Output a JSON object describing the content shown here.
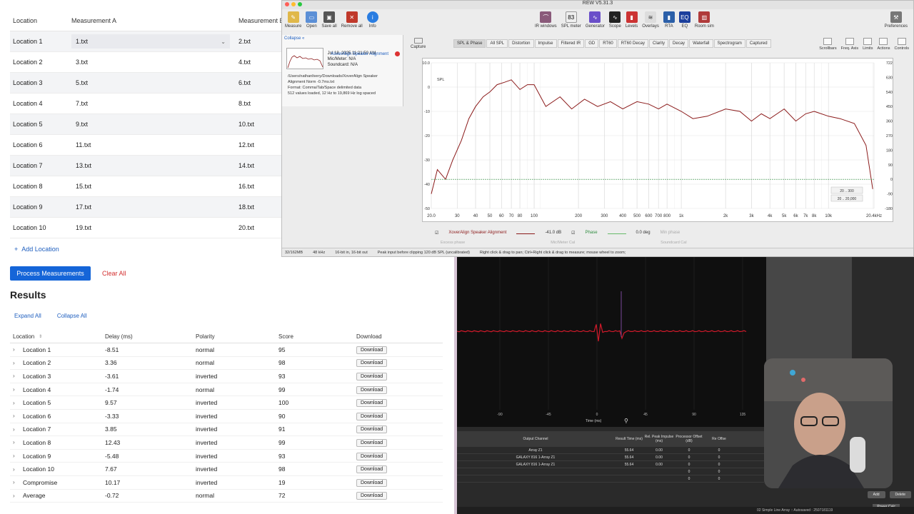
{
  "locations_table": {
    "headers": [
      "Location",
      "Measurement A",
      "Measurement B"
    ],
    "rows": [
      {
        "location": "Location 1",
        "a": "1.txt",
        "b": "2.txt"
      },
      {
        "location": "Location 2",
        "a": "3.txt",
        "b": "4.txt"
      },
      {
        "location": "Location 3",
        "a": "5.txt",
        "b": "6.txt"
      },
      {
        "location": "Location 4",
        "a": "7.txt",
        "b": "8.txt"
      },
      {
        "location": "Location 5",
        "a": "9.txt",
        "b": "10.txt"
      },
      {
        "location": "Location 6",
        "a": "11.txt",
        "b": "12.txt"
      },
      {
        "location": "Location 7",
        "a": "13.txt",
        "b": "14.txt"
      },
      {
        "location": "Location 8",
        "a": "15.txt",
        "b": "16.txt"
      },
      {
        "location": "Location 9",
        "a": "17.txt",
        "b": "18.txt"
      },
      {
        "location": "Location 10",
        "a": "19.txt",
        "b": "20.txt"
      }
    ],
    "add_location": "Add Location"
  },
  "actions": {
    "process": "Process Measurements",
    "clear": "Clear All"
  },
  "results": {
    "title": "Results",
    "expand_all": "Expand All",
    "collapse_all": "Collapse All",
    "headers": {
      "location": "Location",
      "delay": "Delay (ms)",
      "polarity": "Polarity",
      "score": "Score",
      "download": "Download"
    },
    "rows": [
      {
        "location": "Location 1",
        "delay": "-8.51",
        "polarity": "normal",
        "score": "95",
        "download": "Download"
      },
      {
        "location": "Location 2",
        "delay": "3.36",
        "polarity": "normal",
        "score": "98",
        "download": "Download"
      },
      {
        "location": "Location 3",
        "delay": "-3.61",
        "polarity": "inverted",
        "score": "93",
        "download": "Download"
      },
      {
        "location": "Location 4",
        "delay": "-1.74",
        "polarity": "normal",
        "score": "99",
        "download": "Download"
      },
      {
        "location": "Location 5",
        "delay": "9.57",
        "polarity": "inverted",
        "score": "100",
        "download": "Download"
      },
      {
        "location": "Location 6",
        "delay": "-3.33",
        "polarity": "inverted",
        "score": "90",
        "download": "Download"
      },
      {
        "location": "Location 7",
        "delay": "3.85",
        "polarity": "inverted",
        "score": "91",
        "download": "Download"
      },
      {
        "location": "Location 8",
        "delay": "12.43",
        "polarity": "inverted",
        "score": "99",
        "download": "Download"
      },
      {
        "location": "Location 9",
        "delay": "-5.48",
        "polarity": "inverted",
        "score": "93",
        "download": "Download"
      },
      {
        "location": "Location 10",
        "delay": "7.67",
        "polarity": "inverted",
        "score": "98",
        "download": "Download"
      },
      {
        "location": "Compromise",
        "delay": "10.17",
        "polarity": "inverted",
        "score": "19",
        "download": "Download"
      },
      {
        "location": "Average",
        "delay": "-0.72",
        "polarity": "normal",
        "score": "72",
        "download": "Download"
      }
    ]
  },
  "rew": {
    "title": "REW V5.31.3",
    "toolbar_left": [
      "Measure",
      "Open",
      "Save all",
      "Remove all",
      "Info"
    ],
    "toolbar_center": [
      "IR windows",
      "SPL meter",
      "Generator",
      "Scope",
      "Levels",
      "Overlays",
      "RTA",
      "EQ",
      "Room sim"
    ],
    "spl_readout": "83",
    "preferences": "Preferences",
    "collapse": "Collapse",
    "capture": "Capture",
    "measurement": {
      "name": "XoverAlign Speaker Alignment",
      "date": "Jul 18, 2025 11:21:50 AM",
      "mic": "Mic/Meter: N/A",
      "soundcard": "Soundcard: N/A",
      "notes": [
        "/Users/nathanlivery/Downloads/XoverAlign Speaker",
        "Alignment Norm -0.7ms.txt",
        "Format: Comma/Tab/Space delimited data",
        "512 values loaded, 12 Hz to 19,869 Hz log spaced"
      ]
    },
    "tabs": [
      "SPL & Phase",
      "All SPL",
      "Distortion",
      "Impulse",
      "Filtered IR",
      "GD",
      "RT60",
      "RT60 Decay",
      "Clarity",
      "Decay",
      "Waterfall",
      "Spectrogram",
      "Captured"
    ],
    "right_tools": [
      "Scrollbars",
      "Freq. Axis",
      "Limits",
      "Actions",
      "Controls"
    ],
    "spl_selector": "SPL",
    "legend": {
      "trace": "XoverAlign Speaker Alignment",
      "trace_value": "-41.0 dB",
      "phase": "Phase",
      "phase_value": "0.0 deg",
      "min_phase": "Min phase",
      "excess_phase": "Excess phase",
      "mic_cal": "Mic/Meter Cal",
      "source_cal": "Soundcard Cal",
      "unit_deg": "deg",
      "unit_db": "dB"
    },
    "range_boxes": [
      "20 .. 300",
      "20 .. 20,000"
    ],
    "status": [
      "32/162MB",
      "48 kHz",
      "16-bit in, 16-bit out",
      "Peak input before clipping 120 dB SPL (uncalibrated)",
      "Right click & drag to pan; Ctrl+Right click & drag to measure; mouse wheel to zoom;"
    ]
  },
  "chart_data": {
    "type": "line",
    "title": "",
    "xlabel": "",
    "ylabel": "SPL",
    "x_scale": "log",
    "xlim": [
      20,
      20400
    ],
    "ylim": [
      -50,
      10
    ],
    "x_ticks": [
      "20.0",
      "30",
      "40",
      "50",
      "60",
      "70",
      "80",
      "100",
      "200",
      "300",
      "400",
      "500",
      "600",
      "700",
      "800",
      "1k",
      "2k",
      "3k",
      "4k",
      "5k",
      "6k",
      "7k",
      "8k",
      "10k",
      "20.4kHz"
    ],
    "y_ticks": [
      "10.0",
      "0",
      "-10",
      "-20",
      "-30",
      "-40",
      "-50"
    ],
    "y2_ticks": [
      "722",
      "630",
      "540",
      "450",
      "360",
      "270",
      "180",
      "90",
      "0",
      "-90",
      "-180"
    ],
    "series": [
      {
        "name": "XoverAlign Speaker Alignment",
        "color": "#8b1a1a",
        "x": [
          20,
          22,
          25,
          28,
          32,
          36,
          40,
          45,
          50,
          56,
          63,
          70,
          80,
          90,
          100,
          120,
          150,
          180,
          220,
          270,
          330,
          400,
          500,
          600,
          700,
          800,
          1000,
          1200,
          1500,
          2000,
          2500,
          3000,
          3500,
          4000,
          5000,
          6000,
          7000,
          8000,
          10000,
          12000,
          15000,
          18000,
          20000
        ],
        "values": [
          -44,
          -34,
          -38,
          -30,
          -22,
          -13,
          -8,
          -4,
          -2,
          1,
          2,
          3,
          -1,
          1,
          1,
          -8,
          -4,
          -9,
          -5,
          -8,
          -6,
          -9,
          -6,
          -7,
          -9,
          -7,
          -10,
          -13,
          -12,
          -9,
          -10,
          -14,
          -11,
          -13,
          -9,
          -14,
          -11,
          -10,
          -12,
          -13,
          -15,
          -24,
          -42
        ]
      },
      {
        "name": "Phase",
        "color": "#2e8b3e",
        "x": [
          20,
          20400
        ],
        "values": [
          -38,
          -38
        ]
      }
    ]
  },
  "scope": {
    "x_ticks": [
      "-90",
      "-45",
      "0",
      "45",
      "90",
      "135"
    ],
    "xlabel": "Time (ms)",
    "trace_color": "#d11a2a"
  },
  "output_table": {
    "headers": [
      "Output Channel",
      "Result Time (ms)",
      "Rel. Peak Impulse (ms)",
      "Processor Offset (dB)",
      "Re Offse"
    ],
    "rows": [
      {
        "name": "Array Z1",
        "result": "55.64",
        "rel": "0.00",
        "proc": "0",
        "off": "0"
      },
      {
        "name": "GALAXY 816 1-Array Z1",
        "result": "55.64",
        "rel": "0.00",
        "proc": "0",
        "off": "0"
      },
      {
        "name": "GALAXY 816 1-Array Z1",
        "result": "55.64",
        "rel": "0.00",
        "proc": "0",
        "off": "0"
      },
      {
        "name": "",
        "result": "",
        "rel": "",
        "proc": "0",
        "off": "0"
      },
      {
        "name": "",
        "result": "",
        "rel": "",
        "proc": "0",
        "off": "0"
      }
    ],
    "buttons": [
      "Add",
      "Delete"
    ],
    "power_calc": "Power Calc",
    "status": "02 Simple Line Array :: Autosaved : 2507181119"
  },
  "colors": {
    "primary": "#1565d8",
    "danger": "#d32f2f",
    "rew_trace": "#8b1a1a"
  }
}
